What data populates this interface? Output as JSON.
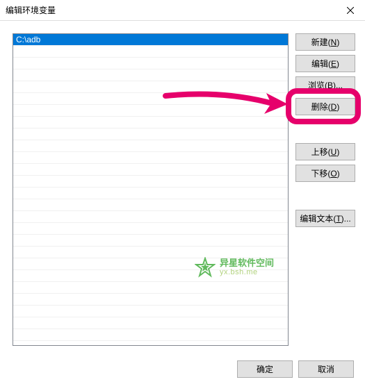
{
  "dialog": {
    "title": "编辑环境变量"
  },
  "list": {
    "items": [
      {
        "value": "C:\\adb",
        "selected": true
      }
    ]
  },
  "sidebar": {
    "new": {
      "label": "新建(",
      "key": "N",
      "suffix": ")"
    },
    "edit": {
      "label": "编辑(",
      "key": "E",
      "suffix": ")"
    },
    "browse": {
      "label": "浏览(",
      "key": "B",
      "suffix": ")..."
    },
    "delete": {
      "label": "删除(",
      "key": "D",
      "suffix": ")"
    },
    "moveup": {
      "label": "上移(",
      "key": "U",
      "suffix": ")"
    },
    "movedown": {
      "label": "下移(",
      "key": "O",
      "suffix": ")"
    },
    "edittext": {
      "label": "编辑文本(",
      "key": "T",
      "suffix": ")..."
    }
  },
  "footer": {
    "ok": "确定",
    "cancel": "取消"
  },
  "watermark": {
    "line1": "异星软件空间",
    "line2": "yx.bsh.me"
  },
  "annotation": {
    "highlight_target": "browse-button",
    "arrow_color": "#e6006b"
  }
}
